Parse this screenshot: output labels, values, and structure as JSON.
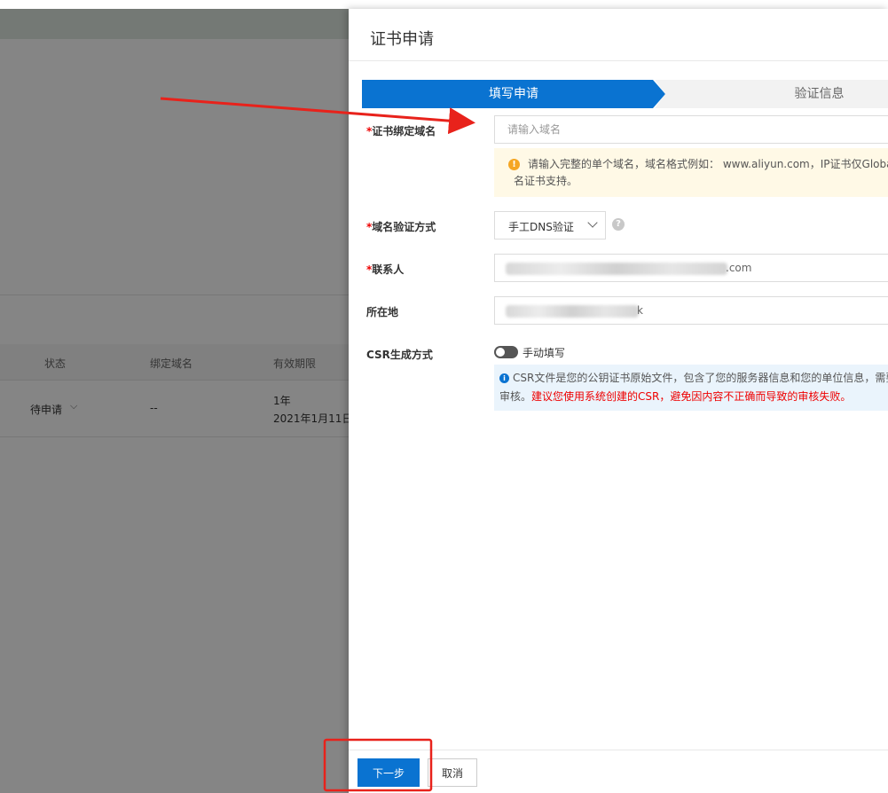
{
  "background": {
    "table": {
      "headers": [
        "状态",
        "绑定域名",
        "有效期限"
      ],
      "row": {
        "status": "待申请",
        "domain": "--",
        "validity_line1": "1年",
        "validity_line2": "2021年1月11日"
      }
    }
  },
  "drawer": {
    "title": "证书申请",
    "steps": [
      {
        "label": "填写申请",
        "active": true
      },
      {
        "label": "验证信息",
        "active": false
      }
    ],
    "form": {
      "domain": {
        "label": "证书绑定域名",
        "required_mark": "*",
        "placeholder": "请输入域名",
        "value": "",
        "tip": "请输入完整的单个域名，域名格式例如： www.aliyun.com，IP证书仅Globalsi",
        "tip_line2": "名证书支持。"
      },
      "verify_method": {
        "label": "域名验证方式",
        "required_mark": "*",
        "selected": "手工DNS验证",
        "help_glyph": "?"
      },
      "contact": {
        "label": "联系人",
        "required_mark": "*",
        "visible_suffix": ".com"
      },
      "location": {
        "label": "所在地",
        "visible_suffix": "k"
      },
      "csr": {
        "label": "CSR生成方式",
        "toggle_label": "手动填写",
        "info_text": "CSR文件是您的公钥证书原始文件，包含了您的服务器信息和您的单位信息，需要",
        "info_text2": "心审核。",
        "info_warning": "建议您使用系统创建的CSR，避免因内容不正确而导致的审核失败。"
      }
    },
    "footer": {
      "next_label": "下一步",
      "cancel_label": "取消"
    }
  },
  "colors": {
    "primary": "#0a73d1",
    "required": "#e00000",
    "annotation": "#e8221b",
    "warning_bg": "#fff9e6",
    "info_bg": "#eaf4fc"
  }
}
